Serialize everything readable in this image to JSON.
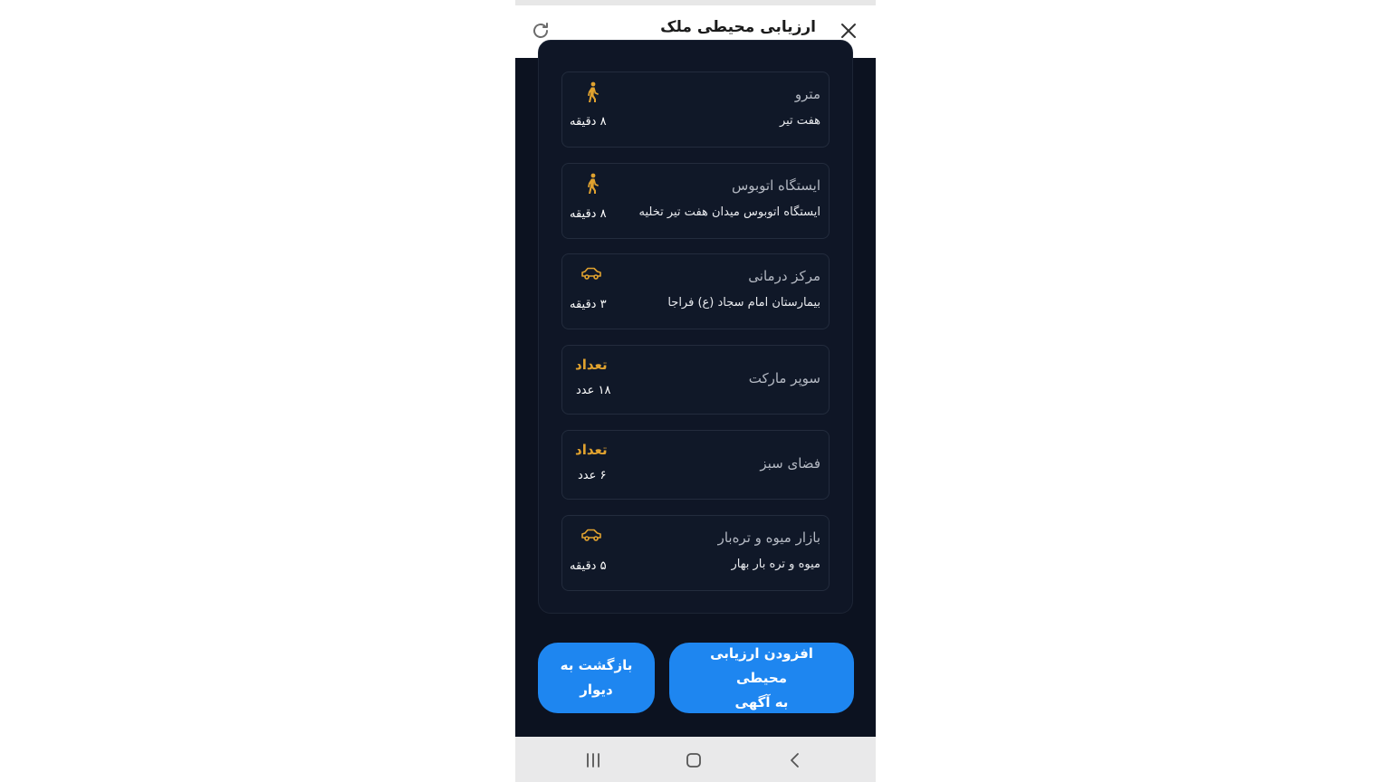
{
  "header": {
    "title": "ارزیابی محیطی ملک",
    "close_icon": "close-icon",
    "refresh_icon": "refresh-icon"
  },
  "colors": {
    "background": "#0c1220",
    "card": "#101828",
    "accent": "#e0a22f",
    "button": "#1e86f0"
  },
  "items": [
    {
      "category": "مترو",
      "place": "هفت تیر",
      "icon": "walking-icon",
      "time": "۸ دقیقه"
    },
    {
      "category": "ایستگاه اتوبوس",
      "place": "ایستگاه اتوبوس میدان هفت تیر تخلیه",
      "icon": "walking-icon",
      "time": "۸ دقیقه"
    },
    {
      "category": "مرکز درمانی",
      "place": "بیمارستان امام سجاد (ع) فراجا",
      "icon": "car-icon",
      "time": "۳ دقیقه"
    },
    {
      "category": "سوپر مارکت",
      "count_label": "تعداد",
      "count": "۱۸ عدد"
    },
    {
      "category": "فضای سبز",
      "count_label": "تعداد",
      "count": "۶ عدد"
    },
    {
      "category": "بازار میوه و تره‌بار",
      "place": "میوه و تره بار بهار",
      "icon": "car-icon",
      "time": "۵ دقیقه"
    }
  ],
  "buttons": {
    "add_line1": "افزودن ارزیابی محیطی",
    "add_line2": "به آگهی",
    "back_line1": "بازگشت به",
    "back_line2": "دیوار"
  },
  "navbar": {
    "recent": "recent-apps-icon",
    "home": "home-icon",
    "back": "back-icon"
  }
}
